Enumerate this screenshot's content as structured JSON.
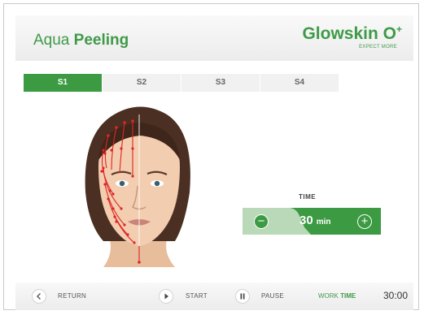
{
  "header": {
    "title_light": "Aqua",
    "title_bold": "Peeling",
    "brand": "Glowskin O",
    "brand_sup": "+",
    "slogan": "EXPECT MORE"
  },
  "tabs": [
    {
      "label": "S1",
      "active": true
    },
    {
      "label": "S2",
      "active": false
    },
    {
      "label": "S3",
      "active": false
    },
    {
      "label": "S4",
      "active": false
    }
  ],
  "time": {
    "label": "TIME",
    "value": "30",
    "unit": "min",
    "minus": "−",
    "plus": "+"
  },
  "footer": {
    "return_label": "RETURN",
    "start_label": "START",
    "pause_label": "PAUSE",
    "work_label": "WORK",
    "work_label_bold": "TIME",
    "work_value": "30:00"
  },
  "colors": {
    "accent": "#3b9a42",
    "arrow": "#e02525"
  },
  "icons": {
    "return": "chevron-left-icon",
    "start": "play-icon",
    "pause": "pause-icon"
  }
}
